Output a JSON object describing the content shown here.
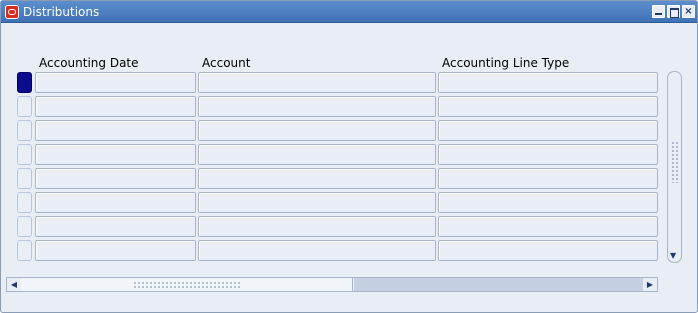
{
  "window": {
    "title": "Distributions"
  },
  "table": {
    "columns": [
      "Accounting Date",
      "Account",
      "Accounting Line Type"
    ],
    "row_count": 8,
    "current_row": 1
  },
  "icons": {
    "app": "oracle-icon",
    "minimize": "minimize-icon",
    "maximize": "maximize-icon",
    "close": "close-icon",
    "scroll_left": "left-arrow-icon",
    "scroll_right": "right-arrow-icon",
    "scroll_down": "down-arrow-icon"
  },
  "glyphs": {
    "close": "×",
    "left": "◀",
    "right": "▶",
    "down": "▼"
  },
  "colors": {
    "titlebar": "#4a7fc2",
    "background": "#e9eef6",
    "current_row": "#0b0b8f"
  }
}
